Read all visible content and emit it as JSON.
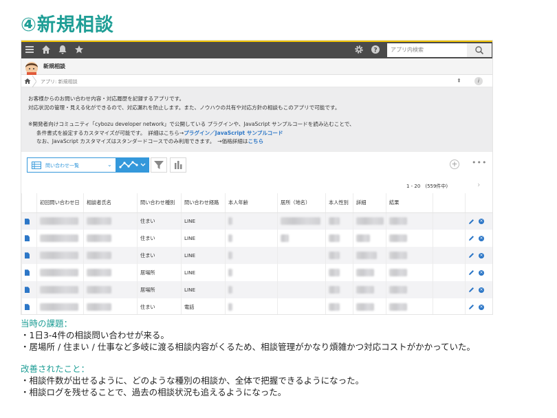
{
  "slide": {
    "title": "④新規相談"
  },
  "topbar": {
    "search_placeholder": "アプリ内検索"
  },
  "app": {
    "name": "新規相談",
    "breadcrumb": "アプリ: 新規相談"
  },
  "description": {
    "line1": "お客様からのお問い合わせ内容・対応履歴を記録するアプリです。",
    "line2": "対応状況の管理・見える化ができるので、対応漏れを防止します。また、ノウハウの共有や対応方針の相談もこのアプリで可能です。",
    "line3": "※開発者向けコミュニティ「cybozu developer network」で公開している プラグインや、JavaScript サンプルコードを読み込むことで、",
    "line4_prefix": "条件書式を設定するカスタマイズが可能です。　詳細はこちら→",
    "line4_link": "プラグイン／JavaScript サンプルコード",
    "line5_prefix": "なお、JavaScript カスタマイズはスタンダードコースでのみ利用できます。　→価格詳細は",
    "line5_link": "こちら"
  },
  "view": {
    "selected": "問い合わせ一覧"
  },
  "pager": {
    "text": "1 - 20　(559件中)"
  },
  "table": {
    "headers": [
      "初回問い合わせ日",
      "相談者氏名",
      "問い合わせ種別",
      "問い合わせ経路",
      "本人年齢",
      "居所（地名）",
      "本人性別",
      "詳細",
      "結果"
    ],
    "rows": [
      {
        "type": "住まい",
        "route": "LINE"
      },
      {
        "type": "住まい",
        "route": "LINE"
      },
      {
        "type": "住まい",
        "route": "LINE"
      },
      {
        "type": "居場所",
        "route": "LINE"
      },
      {
        "type": "居場所",
        "route": "LINE"
      },
      {
        "type": "住まい",
        "route": "電話"
      }
    ]
  },
  "notes": {
    "issues_heading": "当時の課題：",
    "issue1": "・1日3-4件の相談問い合わせが来る。",
    "issue2": "・居場所 / 住まい / 仕事など多岐に渡る相談内容がくるため、相談管理がかなり煩雑かつ対応コストがかかっていた。",
    "improvements_heading": "改善されたこと：",
    "improvement1": "・相談件数が出せるように、どのような種別の相談か、全体で把握できるようになった。",
    "improvement2": "・相談ログを残せることで、過去の相談状況も追えるようになった。"
  },
  "colors": {
    "accent": "#1f9e96",
    "link": "#2d77c7",
    "kintone_blue": "#3498db",
    "topbar": "#4a4a4a"
  }
}
